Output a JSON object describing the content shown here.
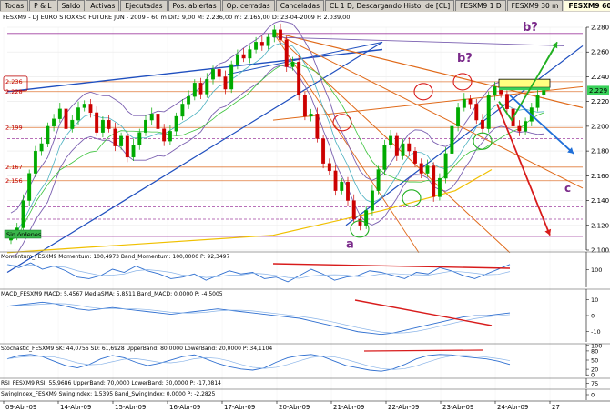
{
  "tabs": [
    {
      "label": "Todas",
      "active": false
    },
    {
      "label": "P & L",
      "active": false
    },
    {
      "label": "Saldo",
      "active": false
    },
    {
      "label": "Activas",
      "active": false
    },
    {
      "label": "Ejecutadas",
      "active": false
    },
    {
      "label": "Pos. abiertas",
      "active": false
    },
    {
      "label": "Op. cerradas",
      "active": false
    },
    {
      "label": "Canceladas",
      "active": false
    },
    {
      "label": "CL 1 D, Descargando Histo. de [CL]",
      "active": false
    },
    {
      "label": "FESXM9 1 D",
      "active": false
    },
    {
      "label": "FESXM9 30 m",
      "active": false
    },
    {
      "label": "FESXM9 60 m",
      "active": true
    }
  ],
  "tab_arrows": [
    "◄",
    "►"
  ],
  "colors": {
    "bg": "#ffffff",
    "candle_up": "#00aa00",
    "candle_down": "#cc0000",
    "trend_blue": "#1f4fbf",
    "trend_orange": "#e06a1a",
    "bollinger": "#7a5fb0",
    "ma_green": "#3cc43c",
    "ma_yellow": "#f0c000",
    "hline_orange": "#e07a3a",
    "hline_purple": "#a040a0",
    "arrow_green": "#22b022",
    "arrow_red": "#d81b1b",
    "arrow_blue": "#1f6fd8",
    "label_purple": "#7a2a8a"
  },
  "chart_data": {
    "type": "candlestick",
    "header": "FESXM9 - DJ EURO STOXX50 FUTURE  JUN - 2009 - 60 m Dif.: 9,00 M: 2.236,00 m: 2.165,00 D: 23-04-2009 F: 2.039,00",
    "price_axis": {
      "min": 2.1,
      "max": 2.28,
      "ticks": [
        "2.280",
        "2.260",
        "2.240",
        "2.220",
        "2.200",
        "2.180",
        "2.160",
        "2.140",
        "2.120",
        "2.100"
      ],
      "current": "2.229"
    },
    "left_levels": [
      "2.236",
      "2.228",
      "2.199",
      "2.167",
      "2.156",
      "2.111"
    ],
    "date_ticks": [
      "09-Abr-09",
      "14-Abr-09",
      "15-Abr-09",
      "16-Abr-09",
      "17-Abr-09",
      "20-Abr-09",
      "21-Abr-09",
      "22-Abr-09",
      "23-Abr-09",
      "24-Abr-09",
      "27"
    ],
    "badges": {
      "sin_ordenes": "Sin órdenes"
    },
    "annotations": [
      "a",
      "b?",
      "b?",
      "c"
    ],
    "candles_close": [
      2.112,
      2.118,
      2.14,
      2.162,
      2.18,
      2.186,
      2.2,
      2.206,
      2.214,
      2.198,
      2.205,
      2.215,
      2.218,
      2.211,
      2.195,
      2.205,
      2.198,
      2.184,
      2.192,
      2.175,
      2.185,
      2.195,
      2.205,
      2.21,
      2.198,
      2.188,
      2.196,
      2.208,
      2.218,
      2.224,
      2.235,
      2.226,
      2.238,
      2.246,
      2.24,
      2.23,
      2.25,
      2.258,
      2.255,
      2.262,
      2.268,
      2.265,
      2.272,
      2.278,
      2.27,
      2.248,
      2.252,
      2.225,
      2.208,
      2.21,
      2.19,
      2.17,
      2.164,
      2.148,
      2.155,
      2.14,
      2.125,
      2.12,
      2.132,
      2.148,
      2.165,
      2.185,
      2.192,
      2.176,
      2.186,
      2.18,
      2.17,
      2.162,
      2.168,
      2.143,
      2.158,
      2.178,
      2.2,
      2.215,
      2.222,
      2.218,
      2.205,
      2.198,
      2.225,
      2.232,
      2.226,
      2.214,
      2.2,
      2.196,
      2.204,
      2.215,
      2.225,
      2.229
    ],
    "panels": [
      {
        "name": "momentum",
        "header": "Momentum_FESXM9 Momentum: 100,4973 Band_Momentum: 100,0000 P: 92,3497",
        "ticks": [
          "100"
        ],
        "values": [
          100.5,
          100.3,
          100.6,
          100.2,
          100.4,
          100.1,
          99.7,
          99.6,
          99.8,
          100.2,
          100.0,
          100.4,
          100.1,
          99.9,
          99.6,
          99.7,
          99.9,
          99.5,
          99.8,
          100.1,
          99.9,
          100.0,
          99.6,
          99.7,
          99.4,
          99.8,
          100.2,
          99.9,
          99.5,
          99.7,
          99.8,
          100.1,
          100.0,
          99.8,
          99.6,
          100.0,
          99.9,
          100.3,
          100.1,
          99.8,
          99.6,
          99.9,
          100.2,
          100.5
        ]
      },
      {
        "name": "macd",
        "header": "MACD_FESXM9 MACD: 5,4567 MediaSMA: 5,8511 Band_MACD: 0,0000 P: -4,5005",
        "ticks": [
          "10",
          "0",
          "-10"
        ],
        "values": [
          9,
          10,
          11,
          12,
          11,
          9,
          7,
          6,
          7,
          8,
          7,
          6,
          5,
          4,
          3,
          4,
          5,
          6,
          7,
          6,
          5,
          4,
          3,
          2,
          1,
          0,
          -2,
          -4,
          -6,
          -8,
          -10,
          -11,
          -12,
          -11,
          -9,
          -7,
          -5,
          -3,
          -1,
          1,
          2,
          2,
          3,
          4
        ]
      },
      {
        "name": "stochastic",
        "header": "Stochastic_FESXM9 SK: 44,0756 SD: 61,6928 UpperBand: 80,0000 LowerBand: 20,0000 P: 34,1104",
        "ticks": [
          "100",
          "80",
          "50",
          "20",
          "0"
        ],
        "values": [
          70,
          85,
          90,
          80,
          60,
          40,
          30,
          45,
          70,
          85,
          75,
          55,
          40,
          50,
          65,
          80,
          88,
          70,
          50,
          35,
          25,
          20,
          30,
          55,
          75,
          85,
          90,
          80,
          60,
          40,
          30,
          20,
          15,
          25,
          45,
          70,
          85,
          90,
          88,
          80,
          75,
          70,
          60,
          45
        ]
      },
      {
        "name": "rsi",
        "header": "RSI_FESXM9 RSI: 55,9686 UpperBand: 70,0000 LowerBand: 30,0000 P: -17,0814",
        "ticks": [
          "75"
        ],
        "values": []
      },
      {
        "name": "swing",
        "header": "SwingIndex_FESXM9 SwingIndex: 1,5395 Band_SwingIndex: 0,0000 P: -2,2825",
        "ticks": [
          "0"
        ],
        "values": []
      }
    ]
  }
}
